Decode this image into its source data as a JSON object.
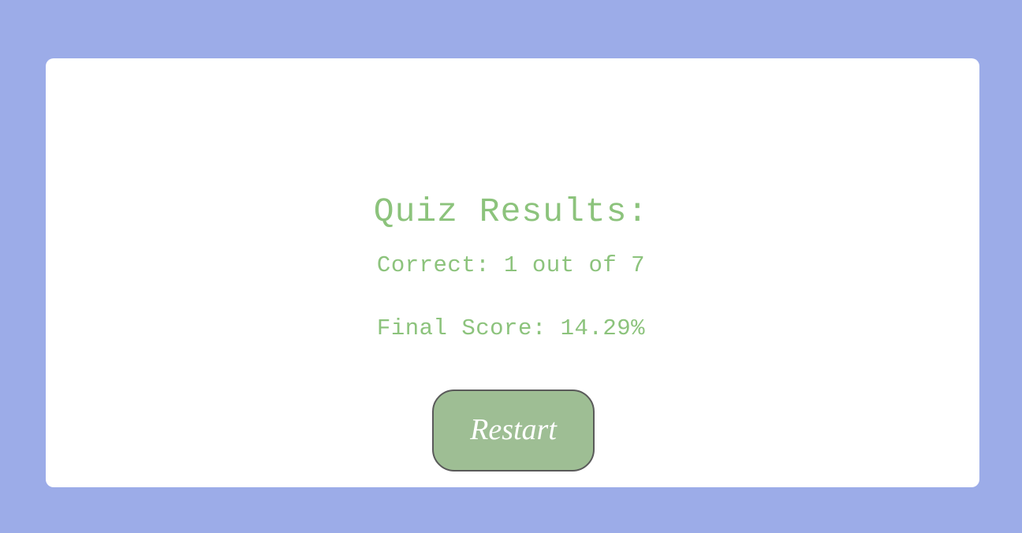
{
  "results": {
    "title": "Quiz Results:",
    "correct_text": "Correct: 1 out of 7",
    "final_score_text": "Final Score: 14.29%",
    "correct": 1,
    "total": 7,
    "final_score_percent": 14.29
  },
  "actions": {
    "restart_label": "Restart"
  },
  "colors": {
    "background": "#9cace8",
    "card": "#ffffff",
    "text": "#8cc37c",
    "button": "#9ebe94",
    "button_border": "#5a5a5a"
  }
}
